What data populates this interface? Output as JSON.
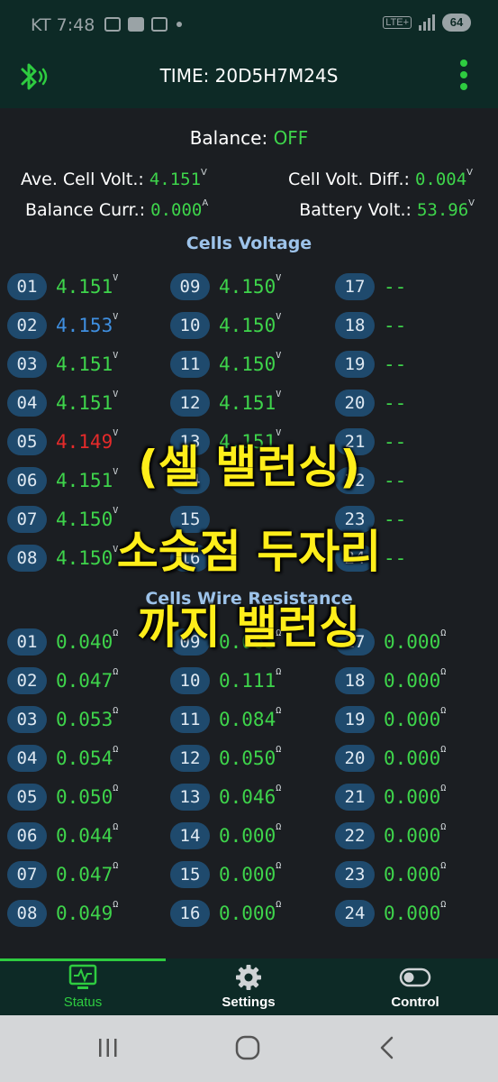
{
  "statusbar": {
    "time": "KT 7:48",
    "network": "LTE+",
    "battery": "64"
  },
  "header": {
    "time": "TIME: 20D5H7M24S"
  },
  "summary": {
    "balance_label": "Balance: ",
    "balance_value": "OFF",
    "ave_label": "Ave. Cell Volt.: ",
    "ave_value": "4.151",
    "ave_unit": "V",
    "diff_label": "Cell Volt. Diff.: ",
    "diff_value": "0.004",
    "diff_unit": "V",
    "curr_label": "Balance Curr.: ",
    "curr_value": "0.000",
    "curr_unit": "A",
    "batt_label": "Battery Volt.: ",
    "batt_value": "53.96",
    "batt_unit": "V"
  },
  "voltage": {
    "title": "Cells Voltage",
    "unit": "V",
    "cells": [
      {
        "id": "01",
        "value": "4.151"
      },
      {
        "id": "02",
        "value": "4.153",
        "color": "#3f8fe0"
      },
      {
        "id": "03",
        "value": "4.151"
      },
      {
        "id": "04",
        "value": "4.151"
      },
      {
        "id": "05",
        "value": "4.149",
        "color": "#e52a2a"
      },
      {
        "id": "06",
        "value": "4.151"
      },
      {
        "id": "07",
        "value": "4.150"
      },
      {
        "id": "08",
        "value": "4.150"
      },
      {
        "id": "09",
        "value": "4.150"
      },
      {
        "id": "10",
        "value": "4.150"
      },
      {
        "id": "11",
        "value": "4.150"
      },
      {
        "id": "12",
        "value": "4.151"
      },
      {
        "id": "13",
        "value": "4.151"
      },
      {
        "id": "14",
        "value": ""
      },
      {
        "id": "15",
        "value": ""
      },
      {
        "id": "16",
        "value": ""
      },
      {
        "id": "17",
        "value": "--"
      },
      {
        "id": "18",
        "value": "--"
      },
      {
        "id": "19",
        "value": "--"
      },
      {
        "id": "20",
        "value": "--"
      },
      {
        "id": "21",
        "value": "--"
      },
      {
        "id": "22",
        "value": "--"
      },
      {
        "id": "23",
        "value": "--"
      },
      {
        "id": "24",
        "value": "--"
      }
    ]
  },
  "resistance": {
    "title": "Cells Wire Resistance",
    "unit": "Ω",
    "cells": [
      {
        "id": "01",
        "value": "0.040"
      },
      {
        "id": "02",
        "value": "0.047"
      },
      {
        "id": "03",
        "value": "0.053"
      },
      {
        "id": "04",
        "value": "0.054"
      },
      {
        "id": "05",
        "value": "0.050"
      },
      {
        "id": "06",
        "value": "0.044"
      },
      {
        "id": "07",
        "value": "0.047"
      },
      {
        "id": "08",
        "value": "0.049"
      },
      {
        "id": "09",
        "value": "0.063"
      },
      {
        "id": "10",
        "value": "0.111"
      },
      {
        "id": "11",
        "value": "0.084"
      },
      {
        "id": "12",
        "value": "0.050"
      },
      {
        "id": "13",
        "value": "0.046"
      },
      {
        "id": "14",
        "value": "0.000"
      },
      {
        "id": "15",
        "value": "0.000"
      },
      {
        "id": "16",
        "value": "0.000"
      },
      {
        "id": "17",
        "value": "0.000"
      },
      {
        "id": "18",
        "value": "0.000"
      },
      {
        "id": "19",
        "value": "0.000"
      },
      {
        "id": "20",
        "value": "0.000"
      },
      {
        "id": "21",
        "value": "0.000"
      },
      {
        "id": "22",
        "value": "0.000"
      },
      {
        "id": "23",
        "value": "0.000"
      },
      {
        "id": "24",
        "value": "0.000"
      }
    ]
  },
  "overlay": {
    "line1": "(셀 밸런싱)",
    "line2": "소숫점 두자리",
    "line3": "까지 밸런싱"
  },
  "nav": {
    "status": "Status",
    "settings": "Settings",
    "control": "Control"
  },
  "colors": {
    "accent": "#2ecc40",
    "value": "#3ed44b",
    "pill": "#1f4a6d",
    "header_bg": "#0d2a26",
    "caption": "#ffee1a"
  },
  "icons": {
    "bluetooth": "bluetooth-icon",
    "menu": "more-vert-icon",
    "status": "monitor-pulse-icon",
    "settings": "gear-icon",
    "control": "toggle-icon"
  }
}
